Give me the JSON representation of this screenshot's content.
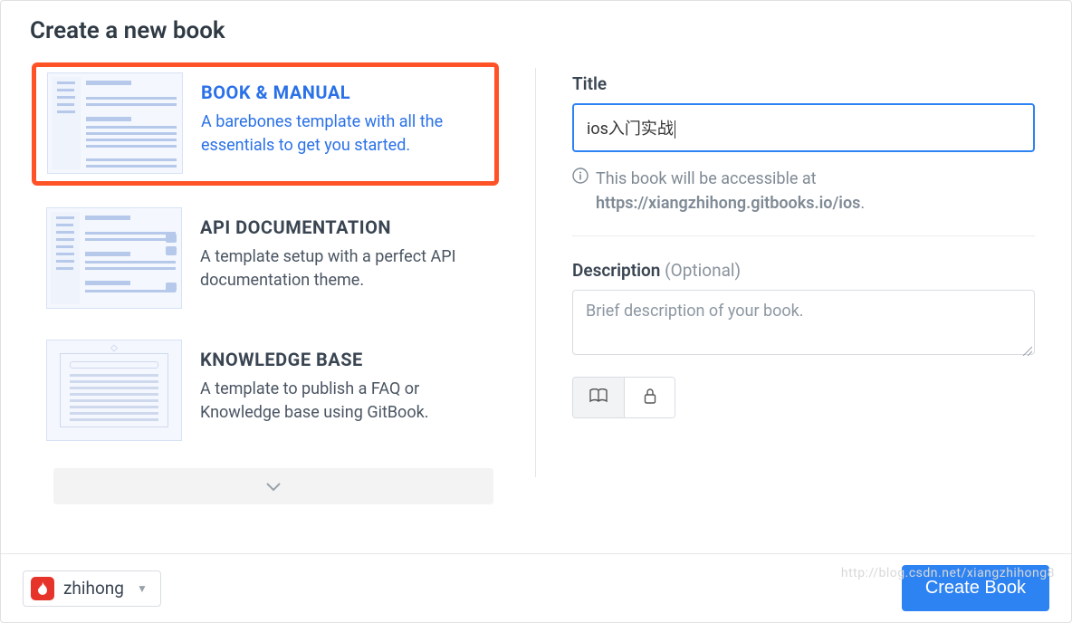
{
  "page_title": "Create a new book",
  "templates": [
    {
      "title": "BOOK & MANUAL",
      "desc": "A barebones template with all the essentials to get you started.",
      "selected": true
    },
    {
      "title": "API DOCUMENTATION",
      "desc": "A template setup with a perfect API documentation theme.",
      "selected": false
    },
    {
      "title": "KNOWLEDGE BASE",
      "desc": "A template to publish a FAQ or Knowledge base using GitBook.",
      "selected": false
    }
  ],
  "form": {
    "title_label": "Title",
    "title_value": "ios入门实战",
    "hint_prefix": "This book will be accessible at ",
    "hint_url": "https://xiangzhihong.gitbooks.io/ios",
    "hint_suffix": ".",
    "description_label": "Description",
    "description_optional": "(Optional)",
    "description_placeholder": "Brief description of your book."
  },
  "footer": {
    "owner": "zhihong",
    "create_label": "Create Book"
  },
  "watermark": "http://blog.csdn.net/xiangzhihong8"
}
